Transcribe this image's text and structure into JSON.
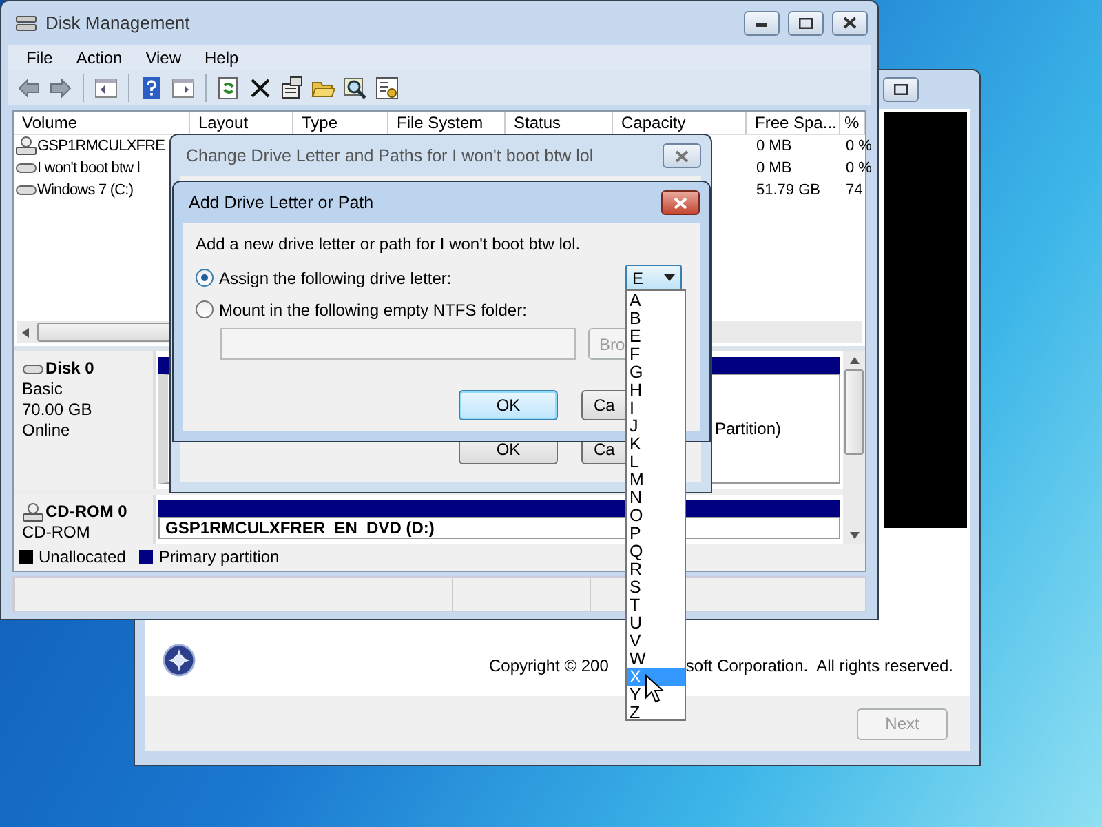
{
  "setup_window": {
    "copyright_left": "Copyright © 200",
    "copyright_right": "soft Corporation.  All rights reserved.",
    "next_button": {
      "label": "Next",
      "disabled": true
    }
  },
  "disk_management": {
    "title": "Disk Management",
    "menu": [
      "File",
      "Action",
      "View",
      "Help"
    ],
    "volume_list": {
      "columns": [
        "Volume",
        "Layout",
        "Type",
        "File System",
        "Status",
        "Capacity",
        "Free Spa...",
        "%"
      ],
      "rows": [
        {
          "kind": "cd",
          "volume": "GSP1RMCULXFRE",
          "free_space": "0 MB",
          "percent_free": "0 %"
        },
        {
          "kind": "disk",
          "volume": "I won't boot btw l",
          "free_space": "0 MB",
          "percent_free": "0 %"
        },
        {
          "kind": "disk",
          "volume": "Windows 7 (C:)",
          "free_space": "51.79 GB",
          "percent_free": "74"
        }
      ]
    },
    "disks": [
      {
        "kind": "disk",
        "name": "Disk 0",
        "lines": [
          "Basic",
          "70.00 GB",
          "Online"
        ],
        "partition_label": "Partition)"
      },
      {
        "kind": "cdrom",
        "name": "CD-ROM 0",
        "lines": [
          "CD-ROM"
        ],
        "partition_label": "GSP1RMCULXFRER_EN_DVD  (D:)"
      }
    ],
    "legend": [
      {
        "label": "Unallocated",
        "color": "#000000"
      },
      {
        "label": "Primary partition",
        "color": "#000080"
      }
    ]
  },
  "change_dialog": {
    "title": "Change Drive Letter and Paths for I won't boot btw lol",
    "buttons": [
      "OK",
      "Ca"
    ]
  },
  "add_dialog": {
    "title": "Add Drive Letter or Path",
    "prompt": "Add a new drive letter or path for I won't boot btw lol.",
    "options": [
      {
        "label": "Assign the following drive letter:",
        "selected": true
      },
      {
        "label": "Mount in the following empty NTFS folder:",
        "selected": false
      }
    ],
    "drive_letter": "E",
    "browse_button": "Bro",
    "buttons": [
      "OK",
      "Ca"
    ],
    "letter_list": [
      {
        "label": "A",
        "selected": false
      },
      {
        "label": "B",
        "selected": false
      },
      {
        "label": "E",
        "selected": false
      },
      {
        "label": "F",
        "selected": false
      },
      {
        "label": "G",
        "selected": false
      },
      {
        "label": "H",
        "selected": false
      },
      {
        "label": "I",
        "selected": false
      },
      {
        "label": "J",
        "selected": false
      },
      {
        "label": "K",
        "selected": false
      },
      {
        "label": "L",
        "selected": false
      },
      {
        "label": "M",
        "selected": false
      },
      {
        "label": "N",
        "selected": false
      },
      {
        "label": "O",
        "selected": false
      },
      {
        "label": "P",
        "selected": false
      },
      {
        "label": "Q",
        "selected": false
      },
      {
        "label": "R",
        "selected": false
      },
      {
        "label": "S",
        "selected": false
      },
      {
        "label": "T",
        "selected": false
      },
      {
        "label": "U",
        "selected": false
      },
      {
        "label": "V",
        "selected": false
      },
      {
        "label": "W",
        "selected": false
      },
      {
        "label": "X",
        "selected": true
      },
      {
        "label": "Y",
        "selected": false
      },
      {
        "label": "Z",
        "selected": false
      }
    ]
  }
}
